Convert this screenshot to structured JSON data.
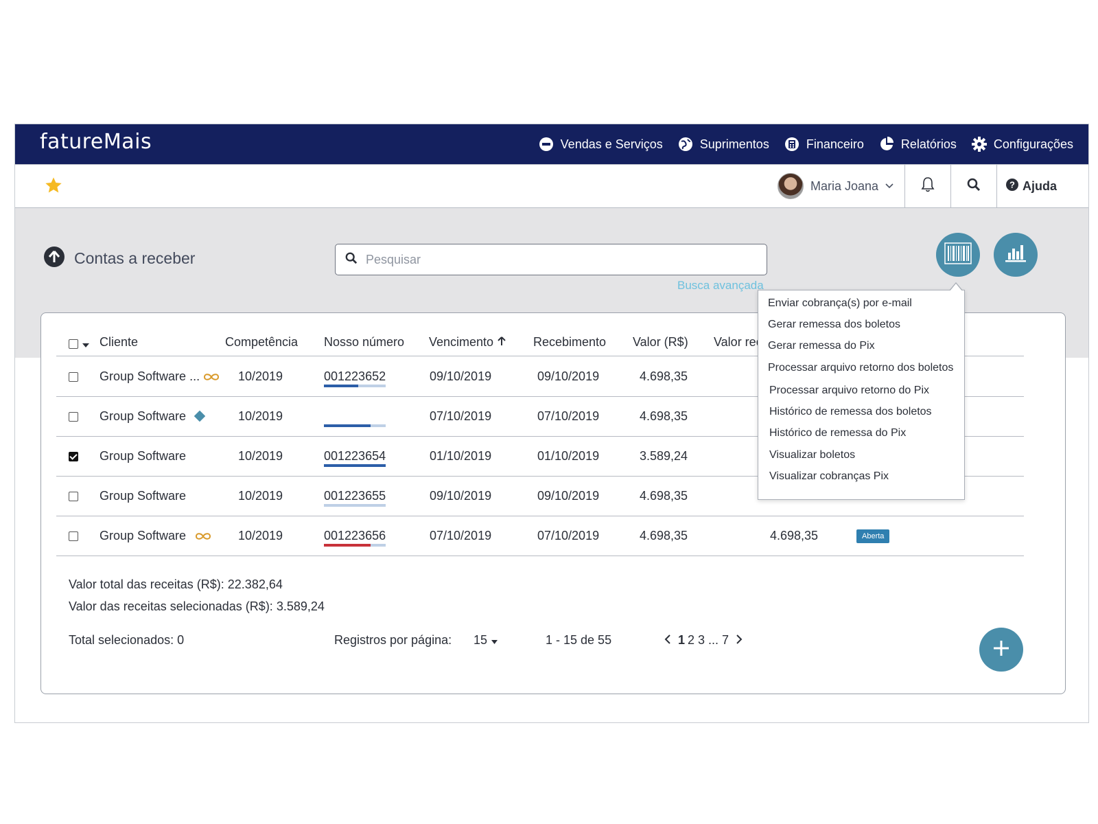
{
  "brand": {
    "logo_text": "fatureMais"
  },
  "nav": {
    "items": [
      {
        "label": "Vendas e Serviços",
        "icon": "minus-circle-icon"
      },
      {
        "label": "Suprimentos",
        "icon": "globe-icon"
      },
      {
        "label": "Financeiro",
        "icon": "calculator-icon"
      },
      {
        "label": "Relatórios",
        "icon": "pie-chart-icon"
      },
      {
        "label": "Configurações",
        "icon": "gear-icon"
      }
    ]
  },
  "userbar": {
    "user_name": "Maria Joana",
    "help_label": "Ajuda"
  },
  "page": {
    "title": "Contas a receber",
    "search_placeholder": "Pesquisar",
    "advanced_search": "Busca avançada"
  },
  "table": {
    "headers": {
      "client": "Cliente",
      "competence": "Competência",
      "our_number": "Nosso número",
      "due": "Vencimento",
      "received": "Recebimento",
      "value": "Valor (R$)",
      "value_received": "Valor rec"
    },
    "rows": [
      {
        "client": "Group Software ...",
        "icon": "infinity-icon",
        "competence": "10/2019",
        "our_number": "001223652",
        "due": "09/10/2019",
        "received": "09/10/2019",
        "value": "4.698,35",
        "value_received": "",
        "status": "",
        "checked": false,
        "progress": 0.55,
        "progress_color": "#2c5ea8"
      },
      {
        "client": "Group Software",
        "icon": "diamond-icon",
        "competence": "10/2019",
        "our_number": "",
        "due": "07/10/2019",
        "received": "07/10/2019",
        "value": "4.698,35",
        "value_received": "",
        "status": "",
        "checked": false,
        "progress": 0.75,
        "progress_color": "#2c5ea8"
      },
      {
        "client": "Group Software",
        "icon": "",
        "competence": "10/2019",
        "our_number": "001223654",
        "due": "01/10/2019",
        "received": "01/10/2019",
        "value": "3.589,24",
        "value_received": "",
        "status": "",
        "checked": true,
        "progress": 1.0,
        "progress_color": "#2c5ea8"
      },
      {
        "client": "Group Software",
        "icon": "",
        "competence": "10/2019",
        "our_number": "001223655",
        "due": "09/10/2019",
        "received": "09/10/2019",
        "value": "4.698,35",
        "value_received": "",
        "status": "",
        "checked": false,
        "progress": 0.0,
        "progress_color": "#2c5ea8"
      },
      {
        "client": "Group Software",
        "icon": "infinity-icon",
        "competence": "10/2019",
        "our_number": "001223656",
        "due": "07/10/2019",
        "received": "07/10/2019",
        "value": "4.698,35",
        "value_received": "4.698,35",
        "status": "Aberta",
        "checked": false,
        "progress": 0.75,
        "progress_color": "#c8323a"
      }
    ]
  },
  "summary": {
    "total_label": "Valor total das receitas (R$):",
    "total_value": "22.382,64",
    "selected_label": "Valor das receitas selecionadas (R$):",
    "selected_value": "3.589,24"
  },
  "footer": {
    "total_selected": "Total selecionados: 0",
    "per_page_label": "Registros por página:",
    "per_page_value": "15",
    "range": "1 - 15 de 55",
    "pages": {
      "current": "1",
      "rest": "2 3 ... 7"
    }
  },
  "dropdown": {
    "items": [
      "Enviar cobrança(s) por e-mail",
      "Gerar remessa dos boletos",
      "Gerar remessa do Pix",
      "Processar arquivo retorno dos boletos",
      "Processar arquivo retorno do Pix",
      "Histórico de remessa dos boletos",
      "Histórico de remessa do Pix",
      "Visualizar boletos",
      "Visualizar cobranças Pix"
    ]
  },
  "colors": {
    "nav_bg": "#14205e",
    "accent": "#4a8eaa",
    "link": "#6ec1de",
    "status_open": "#2f7fb0"
  }
}
